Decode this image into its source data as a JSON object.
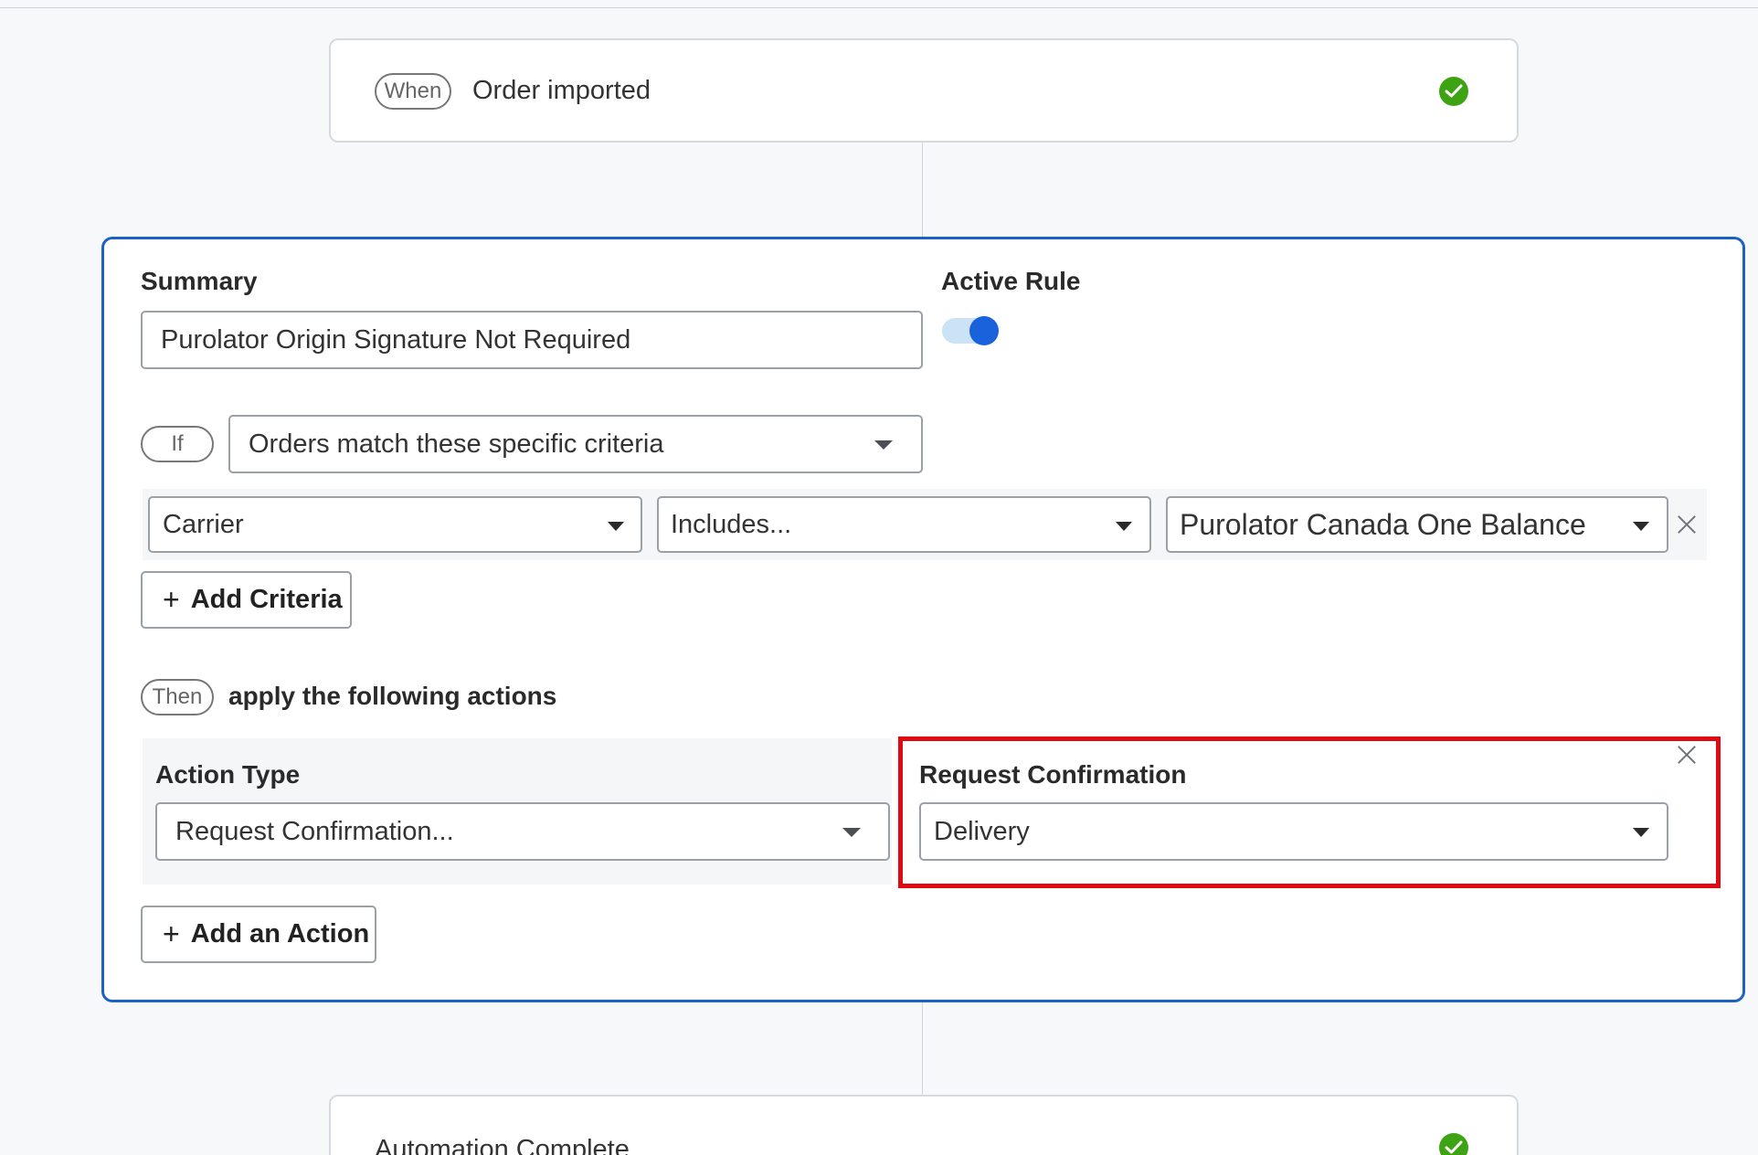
{
  "trigger": {
    "pill": "When",
    "text": "Order imported"
  },
  "rule": {
    "summary_label": "Summary",
    "summary_value": "Purolator Origin Signature Not Required",
    "active_label": "Active Rule",
    "active": true,
    "if_pill": "If",
    "match_mode": "Orders match these specific criteria",
    "criteria": [
      {
        "field": "Carrier",
        "operator": "Includes...",
        "value": "Purolator Canada One Balance"
      }
    ],
    "add_criteria": "Add Criteria",
    "then_pill": "Then",
    "then_text": "apply the following actions",
    "action_type_label": "Action Type",
    "action_type_value": "Request Confirmation...",
    "confirmation_label": "Request Confirmation",
    "confirmation_value": "Delivery",
    "add_action": "Add an Action"
  },
  "completion": {
    "text": "Automation Complete"
  },
  "colors": {
    "accent": "#1a62c6",
    "highlight": "#e00b12",
    "success": "#3ea312"
  }
}
